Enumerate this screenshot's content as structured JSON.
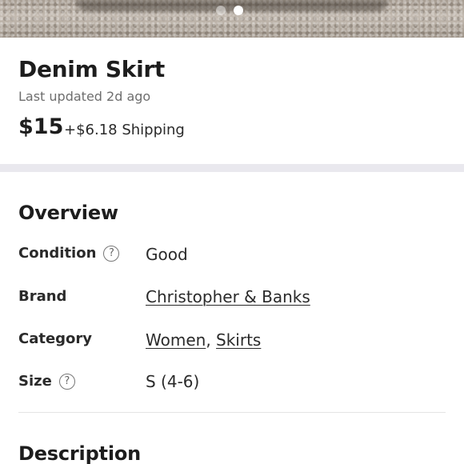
{
  "gallery": {
    "dots": 2,
    "active_dot": 2
  },
  "listing": {
    "title": "Denim Skirt",
    "updated": "Last updated 2d ago",
    "price": "$15",
    "shipping": "+$6.18 Shipping"
  },
  "overview": {
    "title": "Overview",
    "condition_label": "Condition",
    "condition_value": "Good",
    "brand_label": "Brand",
    "brand_value": "Christopher & Banks",
    "category_label": "Category",
    "category_women": "Women",
    "category_sep": ",",
    "category_skirts": "Skirts",
    "size_label": "Size",
    "size_value": "S (4-6)",
    "help_glyph": "?"
  },
  "description": {
    "title": "Description"
  },
  "icons": {
    "help": "question-circle-icon"
  },
  "colors": {
    "text": "#1d1d1d",
    "muted": "#6e6e6e",
    "band": "#e9e8ee"
  }
}
